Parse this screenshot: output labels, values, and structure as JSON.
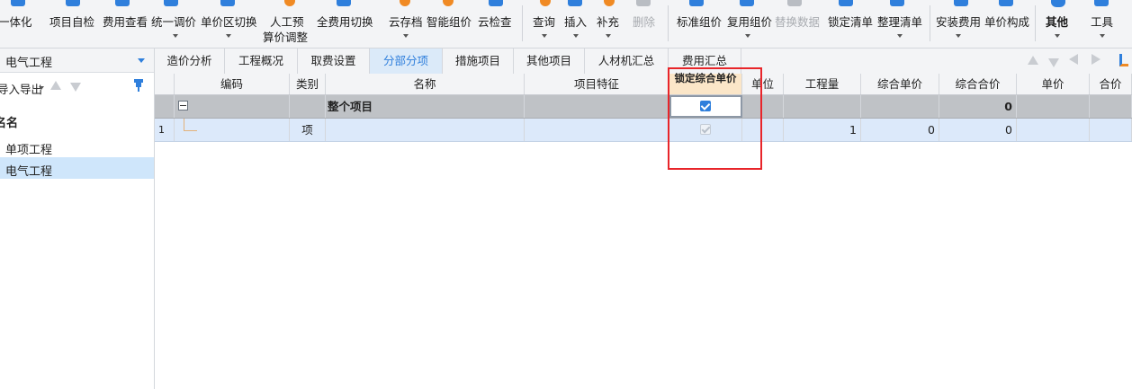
{
  "toolbar": {
    "items": [
      {
        "label": "一体化",
        "icon": "integration-icon"
      },
      {
        "label": "项目自检",
        "icon": "self-check-icon"
      },
      {
        "label": "费用查看",
        "icon": "cost-view-icon"
      },
      {
        "label": "统一调价",
        "icon": "price-adjust-icon"
      },
      {
        "label": "单价区切换",
        "icon": "unit-price-switch-icon"
      },
      {
        "label": "人工预",
        "label2": "算价调整",
        "icon": "labor-budget-icon"
      },
      {
        "label": "全费用切换",
        "icon": "full-cost-switch-icon"
      },
      {
        "label": "云存档",
        "icon": "cloud-archive-icon"
      },
      {
        "label": "智能组价",
        "icon": "smart-pricing-icon"
      },
      {
        "label": "云检查",
        "icon": "cloud-check-icon"
      },
      {
        "label": "查询",
        "icon": "query-icon"
      },
      {
        "label": "插入",
        "icon": "insert-icon"
      },
      {
        "label": "补充",
        "icon": "supplement-icon"
      },
      {
        "label": "删除",
        "icon": "delete-icon"
      },
      {
        "label": "标准组价",
        "icon": "standard-pricing-icon"
      },
      {
        "label": "复用组价",
        "icon": "reuse-pricing-icon"
      },
      {
        "label": "替换数据",
        "icon": "replace-data-icon"
      },
      {
        "label": "锁定清单",
        "icon": "lock-list-icon"
      },
      {
        "label": "整理清单",
        "icon": "organize-list-icon"
      },
      {
        "label": "安装费用",
        "icon": "install-cost-icon"
      },
      {
        "label": "单价构成",
        "icon": "price-composition-icon"
      },
      {
        "label": "其他",
        "icon": "other-icon"
      },
      {
        "label": "工具",
        "icon": "tools-icon"
      }
    ]
  },
  "left_panel": {
    "project_selector": "电气工程",
    "import_export_label": "导入导出",
    "tree_header": "名名",
    "tree_items": [
      "单项工程",
      "电气工程"
    ]
  },
  "tabs": [
    "造价分析",
    "工程概况",
    "取费设置",
    "分部分项",
    "措施项目",
    "其他项目",
    "人材机汇总",
    "费用汇总"
  ],
  "active_tab": "分部分项",
  "grid": {
    "columns": {
      "code": "编码",
      "category": "类别",
      "name": "名称",
      "feature": "项目特征",
      "lock_price": "锁定综合单价",
      "unit": "单位",
      "quantity": "工程量",
      "composite_price": "综合单价",
      "composite_total": "综合合价",
      "unit_price": "单价",
      "total": "合价"
    },
    "total_row": {
      "name": "整个项目",
      "composite_total": "0",
      "lock_checked": true
    },
    "item_row": {
      "index": "1",
      "category": "项",
      "quantity": "1",
      "composite_price": "0",
      "composite_total": "0",
      "lock_checked": true,
      "lock_disabled": true
    }
  },
  "colors": {
    "accent": "#2f7fdc",
    "highlight": "#e8252a",
    "selected_row": "#dce9fa",
    "total_row": "#bfc2c6"
  }
}
